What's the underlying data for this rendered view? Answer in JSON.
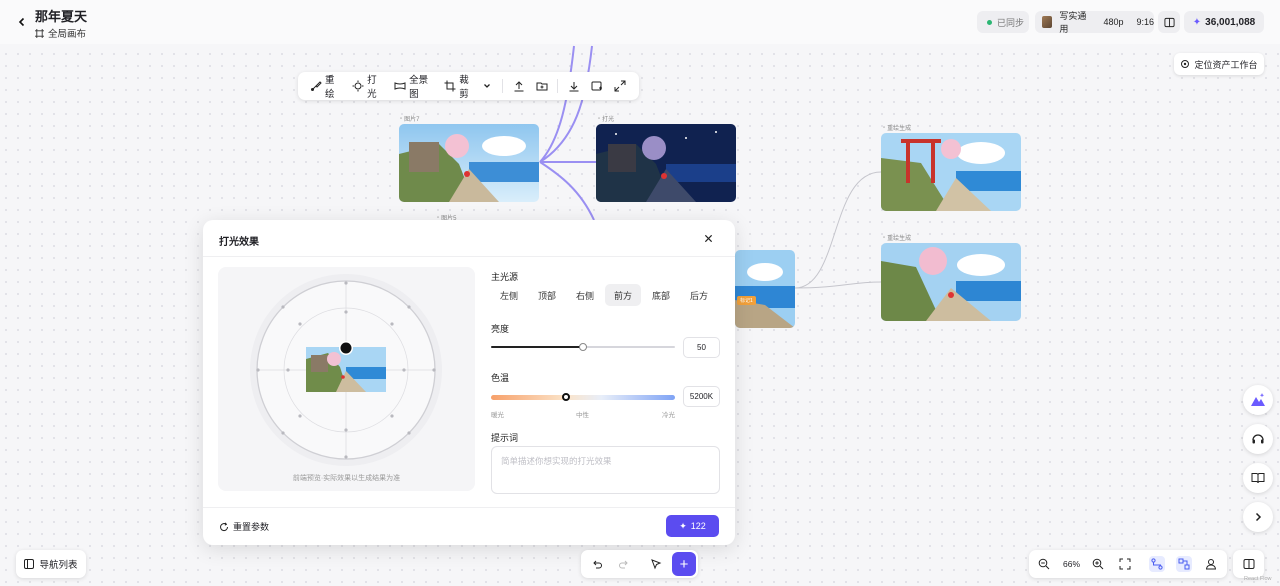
{
  "header": {
    "back_icon": "chevron-left-icon",
    "title": "那年夏天",
    "subtitle": "全局画布",
    "sync_status": "已同步",
    "model_name": "写实通用",
    "resolution": "480p",
    "aspect": "9:16",
    "credits": "36,001,088",
    "colors": {
      "accent": "#5b4cf0",
      "sync_dot": "#2bb673"
    }
  },
  "locate_button": "定位资产工作台",
  "toolbar": {
    "items": [
      {
        "label": "重绘",
        "icon": "brush-icon"
      },
      {
        "label": "打光",
        "icon": "light-icon"
      },
      {
        "label": "全景图",
        "icon": "panorama-icon"
      },
      {
        "label": "裁剪",
        "icon": "crop-icon"
      }
    ]
  },
  "nodes": {
    "image7_label": "图片7",
    "light_label": "打光",
    "image_label2": "图片5",
    "redraw_label_1": "重绘生成",
    "redraw_label_2": "重绘生成",
    "tag": "标记1"
  },
  "lighting_modal": {
    "title": "打光效果",
    "preview_note": "前端预览·实际效果以生成结果为准",
    "light_source_label": "主光源",
    "directions": [
      "左侧",
      "顶部",
      "右侧",
      "前方",
      "底部",
      "后方"
    ],
    "selected_direction": "前方",
    "brightness_label": "亮度",
    "brightness": 50,
    "brightness_display": "50",
    "temperature_label": "色温",
    "temperature_display": "5200K",
    "temperature_fraction": 0.41,
    "temp_scale": {
      "warm": "暖光",
      "neutral": "中性",
      "cool": "冷光"
    },
    "prompt_label": "提示词",
    "prompt_placeholder": "简单描述你想实现的打光效果",
    "reset_label": "重置参数",
    "generate_cost": "122"
  },
  "bottom": {
    "nav_list": "导航列表",
    "zoom": "66%",
    "attribution": "React Flow"
  }
}
